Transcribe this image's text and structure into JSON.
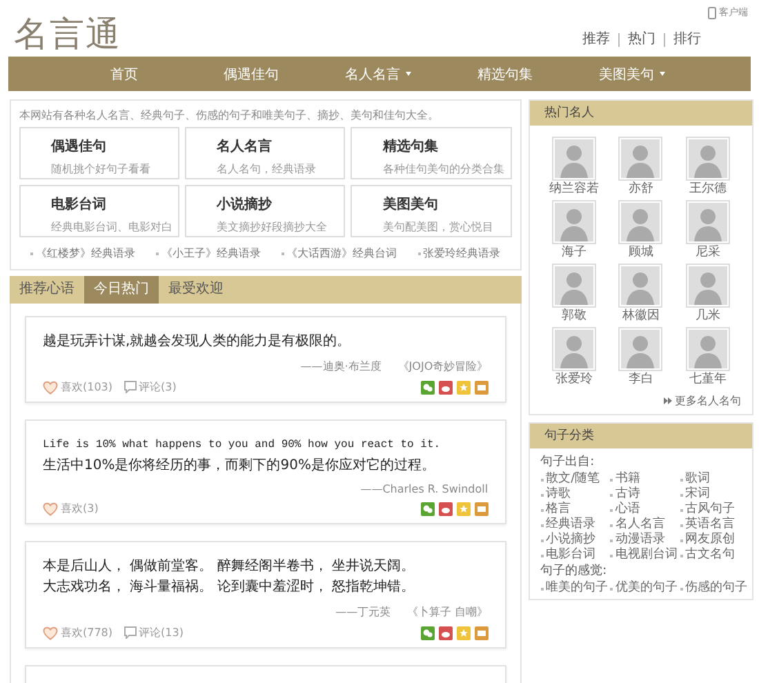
{
  "header": {
    "logo": "名言通",
    "client_link": "客户端",
    "top_links": [
      "推荐",
      "热门",
      "排行"
    ]
  },
  "nav": [
    {
      "label": "首页",
      "dropdown": false
    },
    {
      "label": "偶遇佳句",
      "dropdown": false
    },
    {
      "label": "名人名言",
      "dropdown": true
    },
    {
      "label": "精选句集",
      "dropdown": false
    },
    {
      "label": "美图美句",
      "dropdown": true
    }
  ],
  "intro": {
    "text": "本网站有各种名人名言、经典句子、伤感的句子和唯美句子、摘抄、美句和佳句大全。",
    "categories": [
      {
        "title": "偶遇佳句",
        "desc": "随机挑个好句子看看"
      },
      {
        "title": "名人名言",
        "desc": "名人名句，经典语录"
      },
      {
        "title": "精选句集",
        "desc": "各种佳句美句的分类合集"
      },
      {
        "title": "电影台词",
        "desc": "经典电影台词、电影对白"
      },
      {
        "title": "小说摘抄",
        "desc": "美文摘抄好段摘抄大全"
      },
      {
        "title": "美图美句",
        "desc": "美句配美图，赏心悦目"
      }
    ],
    "links": [
      "《红楼梦》经典语录",
      "《小王子》经典语录",
      "《大话西游》经典台词",
      "张爱玲经典语录"
    ]
  },
  "tabs": [
    {
      "label": "推荐心语",
      "selected": false
    },
    {
      "label": "今日热门",
      "selected": true
    },
    {
      "label": "最受欢迎",
      "selected": false
    }
  ],
  "quotes": [
    {
      "lines": [
        "越是玩弄计谋,就越会发现人类的能力是有极限的。"
      ],
      "author": "——迪奥·布兰度",
      "source": "《JOJO奇妙冒险》",
      "likes": "喜欢(103)",
      "comments": "评论(3)"
    },
    {
      "lines": [
        "Life is 10% what happens to you and 90% how you react to it.",
        "生活中10%是你将经历的事，而剩下的90%是你应对它的过程。"
      ],
      "author": "——Charles R. Swindoll",
      "likes": "喜欢(3)"
    },
    {
      "lines": [
        "本是后山人， 偶做前堂客。 醉舞经阁半卷书， 坐井说天阔。",
        "大志戏功名， 海斗量福祸。 论到囊中羞涩时， 怒指乾坤错。"
      ],
      "author": "——丁元英",
      "source": "《卜算子 自嘲》",
      "likes": "喜欢(778)",
      "comments": "评论(13)"
    }
  ],
  "hot_people": {
    "title": "热门名人",
    "people": [
      "纳兰容若",
      "亦舒",
      "王尔德",
      "海子",
      "顾城",
      "尼采",
      "郭敬",
      "林徽因",
      "几米",
      "张爱玲",
      "李白",
      "七堇年"
    ],
    "more": "更多名人名句"
  },
  "sentence_categories": {
    "title": "句子分类",
    "groups": [
      {
        "heading": "句子出自:",
        "items": [
          "散文/随笔",
          "书籍",
          "歌词",
          "诗歌",
          "古诗",
          "宋词",
          "格言",
          "心语",
          "古风句子",
          "经典语录",
          "名人名言",
          "英语名言",
          "小说摘抄",
          "动漫语录",
          "网友原创",
          "电影台词",
          "电视剧台词",
          "古文名句"
        ]
      },
      {
        "heading": "句子的感觉:",
        "items": [
          "唯美的句子",
          "优美的句子",
          "伤感的句子"
        ]
      }
    ]
  }
}
